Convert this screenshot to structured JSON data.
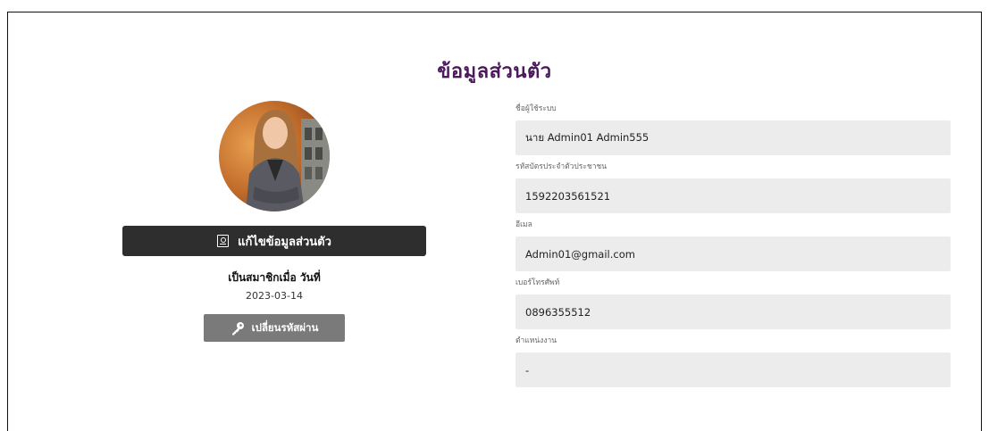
{
  "page": {
    "title": "ข้อมูลส่วนตัว"
  },
  "profile": {
    "edit_button_label": "แก้ไขข้อมูลส่วนตัว",
    "member_since_label": "เป็นสมาชิกเมื่อ วันที่",
    "member_since_date": "2023-03-14",
    "change_password_label": "เปลี่ยนรหัสผ่าน"
  },
  "fields": [
    {
      "label": "ชื่อผู้ใช้ระบบ",
      "value": "นาย Admin01 Admin555"
    },
    {
      "label": "รหัสบัตรประจำตัวประชาชน",
      "value": "1592203561521"
    },
    {
      "label": "อีเมล",
      "value": "Admin01@gmail.com"
    },
    {
      "label": "เบอร์โทรศัพท์",
      "value": "0896355512"
    },
    {
      "label": "ตำแหน่งงาน",
      "value": "-"
    }
  ],
  "icons": {
    "edit": "profile-edit-icon",
    "key": "key-icon"
  },
  "colors": {
    "title": "#4b1a5a",
    "edit_button": "#2e2e2e",
    "password_button": "#7a7a7a",
    "field_bg": "#ececec"
  }
}
